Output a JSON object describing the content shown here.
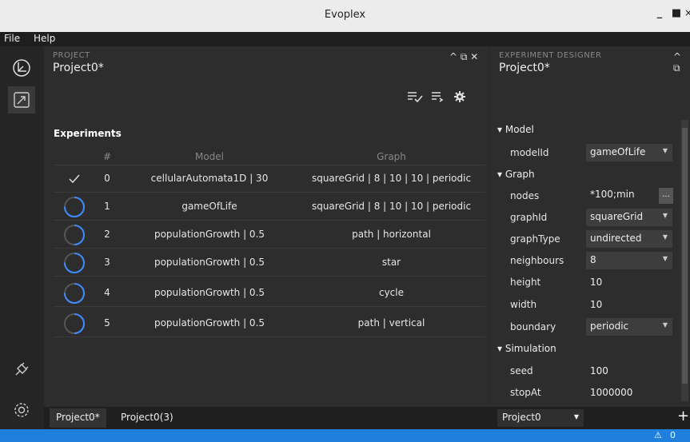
{
  "window": {
    "title": "Evoplex",
    "min": "_",
    "max": "■",
    "close": "×"
  },
  "menu": {
    "file": "File",
    "help": "Help"
  },
  "project_panel": {
    "caption": "PROJECT",
    "title": "Project0*",
    "controls": "^ ⧉ ✕",
    "section_label": "Experiments",
    "columns": {
      "index": "#",
      "model": "Model",
      "graph": "Graph"
    },
    "rows": [
      {
        "status": "done",
        "index": "0",
        "model": "cellularAutomata1D | 30",
        "graph": "squareGrid | 8 | 10 | 10 | periodic",
        "progress": 1.0
      },
      {
        "status": "progress",
        "index": "1",
        "model": "gameOfLife",
        "graph": "squareGrid | 8 | 10 | 10 | periodic",
        "progress": 0.75
      },
      {
        "status": "progress",
        "index": "2",
        "model": "populationGrowth | 0.5",
        "graph": "path | horizontal",
        "progress": 0.5
      },
      {
        "status": "progress",
        "index": "3",
        "model": "populationGrowth | 0.5",
        "graph": "star",
        "progress": 0.75
      },
      {
        "status": "progress",
        "index": "4",
        "model": "populationGrowth | 0.5",
        "graph": "cycle",
        "progress": 0.75
      },
      {
        "status": "progress",
        "index": "5",
        "model": "populationGrowth | 0.5",
        "graph": "path | vertical",
        "progress": 0.5
      }
    ]
  },
  "designer": {
    "caption": "EXPERIMENT DESIGNER",
    "title": "Project0*",
    "controls": "^ ⧉",
    "sections": {
      "model": "▾ Model",
      "graph": "▾ Graph",
      "simulation": "▾ Simulation"
    },
    "fields": {
      "modelId": {
        "label": "modelId",
        "value": "gameOfLife"
      },
      "nodes": {
        "label": "nodes",
        "value": "*100;min",
        "button": "..."
      },
      "graphId": {
        "label": "graphId",
        "value": "squareGrid"
      },
      "graphType": {
        "label": "graphType",
        "value": "undirected"
      },
      "neighbours": {
        "label": "neighbours",
        "value": "8"
      },
      "height": {
        "label": "height",
        "value": "10"
      },
      "width": {
        "label": "width",
        "value": "10"
      },
      "boundary": {
        "label": "boundary",
        "value": "periodic"
      },
      "seed": {
        "label": "seed",
        "value": "100"
      },
      "stopAt": {
        "label": "stopAt",
        "value": "1000000"
      }
    },
    "project_select": "Project0"
  },
  "tabs": [
    "Project0*",
    "Project0(3)"
  ],
  "plus": "+",
  "statusbar": {
    "warning_icon": "⚠",
    "count": "0"
  },
  "colors": {
    "accent": "#3d8bff",
    "statusbar": "#1f7fdf",
    "panel": "#2d2d2d"
  }
}
